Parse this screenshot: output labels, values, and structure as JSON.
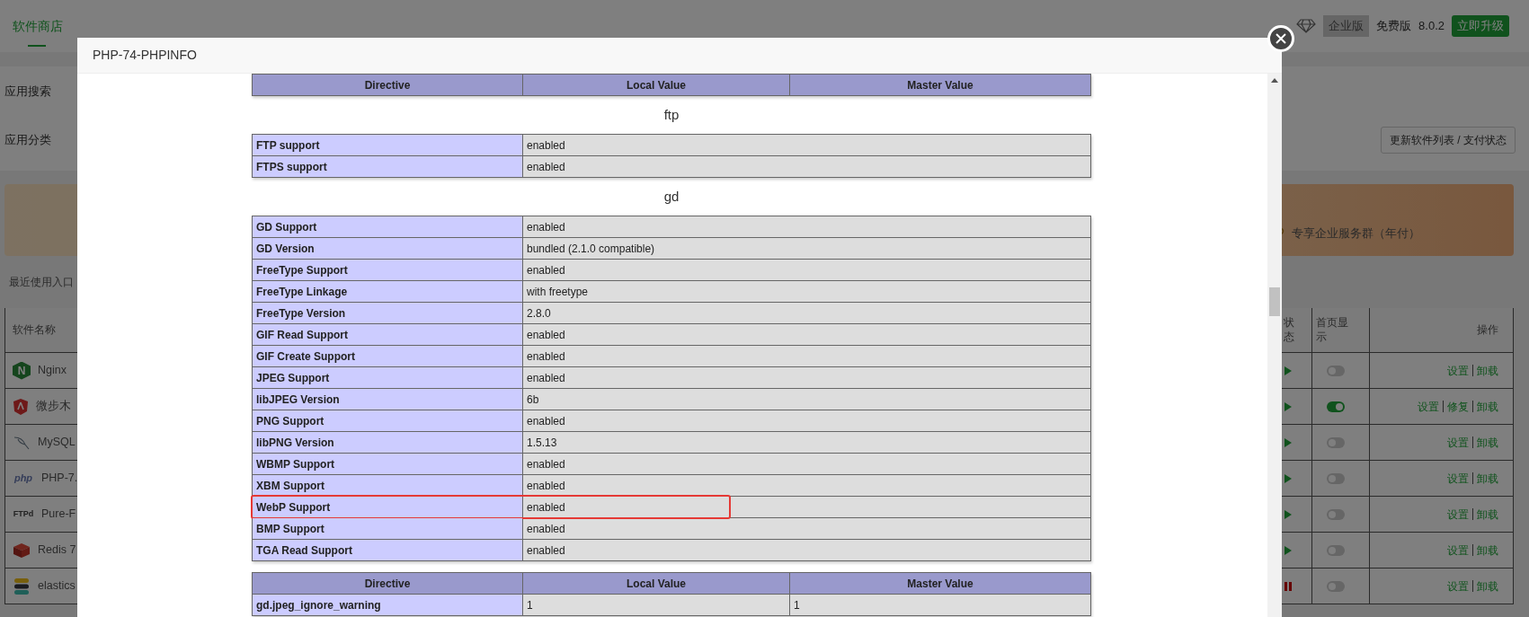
{
  "background_page": {
    "top_tab": {
      "label": "软件商店",
      "selected": true
    },
    "edition": {
      "enterprise": "企业版",
      "free": "免费版",
      "version": "8.0.2",
      "upgrade_button": "立即升级"
    },
    "search_label": "应用搜索",
    "category_label": "应用分类",
    "refresh_button": "更新软件列表 / 支付状态",
    "banner_text": "专享企业服务群（年付）",
    "recent_label": "最近使用入口",
    "software_table": {
      "columns": [
        "软件名称",
        "状态",
        "首页显示",
        "操作"
      ],
      "rows": [
        {
          "name": "Nginx",
          "logo_text": "N",
          "running": true,
          "show_on_home": false,
          "actions": [
            "设置",
            "卸载"
          ]
        },
        {
          "name": "微步木",
          "running": true,
          "show_on_home": true,
          "actions": [
            "设置",
            "修复",
            "卸载"
          ]
        },
        {
          "name": "MySQL",
          "running": true,
          "show_on_home": false,
          "actions": [
            "设置",
            "卸载"
          ]
        },
        {
          "name": "PHP-7.",
          "logo_text": "php",
          "running": true,
          "show_on_home": false,
          "actions": [
            "设置",
            "卸载"
          ]
        },
        {
          "name": "Pure-F",
          "logo_text": "FTPd",
          "running": true,
          "show_on_home": false,
          "actions": [
            "设置",
            "卸载"
          ]
        },
        {
          "name": "Redis 7",
          "running": true,
          "show_on_home": false,
          "actions": [
            "设置",
            "卸载"
          ]
        },
        {
          "name": "elastics",
          "running": false,
          "show_on_home": false,
          "actions": [
            "设置",
            "卸载"
          ]
        }
      ]
    }
  },
  "modal": {
    "title": "PHP-74-PHPINFO",
    "sections": [
      {
        "kind": "directives",
        "columns": [
          "Directive",
          "Local Value",
          "Master Value"
        ]
      },
      {
        "kind": "title",
        "text": "ftp"
      },
      {
        "kind": "info",
        "rows": [
          {
            "label": "FTP support",
            "value": "enabled",
            "highlighted": false
          },
          {
            "label": "FTPS support",
            "value": "enabled",
            "highlighted": false
          }
        ]
      },
      {
        "kind": "title",
        "text": "gd"
      },
      {
        "kind": "info",
        "rows": [
          {
            "label": "GD Support",
            "value": "enabled",
            "highlighted": false
          },
          {
            "label": "GD Version",
            "value": "bundled (2.1.0 compatible)",
            "highlighted": false
          },
          {
            "label": "FreeType Support",
            "value": "enabled",
            "highlighted": false
          },
          {
            "label": "FreeType Linkage",
            "value": "with freetype",
            "highlighted": false
          },
          {
            "label": "FreeType Version",
            "value": "2.8.0",
            "highlighted": false
          },
          {
            "label": "GIF Read Support",
            "value": "enabled",
            "highlighted": false
          },
          {
            "label": "GIF Create Support",
            "value": "enabled",
            "highlighted": false
          },
          {
            "label": "JPEG Support",
            "value": "enabled",
            "highlighted": false
          },
          {
            "label": "libJPEG Version",
            "value": "6b",
            "highlighted": false
          },
          {
            "label": "PNG Support",
            "value": "enabled",
            "highlighted": false
          },
          {
            "label": "libPNG Version",
            "value": "1.5.13",
            "highlighted": false
          },
          {
            "label": "WBMP Support",
            "value": "enabled",
            "highlighted": false
          },
          {
            "label": "XBM Support",
            "value": "enabled",
            "highlighted": false
          },
          {
            "label": "WebP Support",
            "value": "enabled",
            "highlighted": true
          },
          {
            "label": "BMP Support",
            "value": "enabled",
            "highlighted": false
          },
          {
            "label": "TGA Read Support",
            "value": "enabled",
            "highlighted": false
          }
        ]
      },
      {
        "kind": "directives",
        "columns": [
          "Directive",
          "Local Value",
          "Master Value"
        ],
        "rows": [
          [
            "gd.jpeg_ignore_warning",
            "1",
            "1"
          ]
        ]
      }
    ]
  }
}
